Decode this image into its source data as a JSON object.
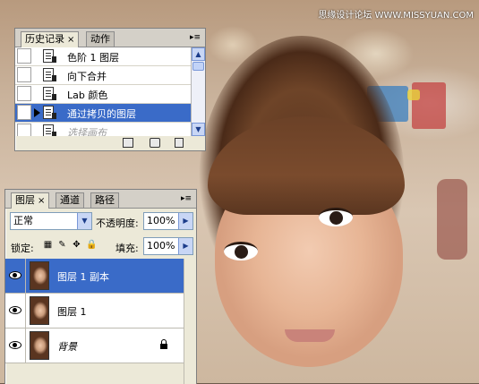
{
  "watermark": "思缘设计论坛 WWW.MISSYUAN.COM",
  "history_panel": {
    "tabs": [
      {
        "label": "历史记录",
        "close": "×"
      },
      {
        "label": "动作"
      }
    ],
    "menu_glyph": "▸≡",
    "items": [
      {
        "label": "色阶 1 图层"
      },
      {
        "label": "向下合并"
      },
      {
        "label": "Lab 颜色"
      },
      {
        "label": "通过拷贝的图层",
        "selected": true
      },
      {
        "label": "选择画布",
        "dimmed": true
      }
    ],
    "footer_icons": [
      "new-document-icon",
      "snapshot-camera-icon",
      "trash-icon"
    ]
  },
  "layers_panel": {
    "tabs": [
      {
        "label": "图层",
        "close": "×"
      },
      {
        "label": "通道"
      },
      {
        "label": "路径"
      }
    ],
    "blend_mode": "正常",
    "opacity_label": "不透明度:",
    "opacity_value": "100%",
    "lock_label": "锁定:",
    "fill_label": "填充:",
    "fill_value": "100%",
    "layers": [
      {
        "name": "图层 1 副本",
        "selected": true,
        "visible": true
      },
      {
        "name": "图层 1",
        "selected": false,
        "visible": true
      },
      {
        "name": "背景",
        "selected": false,
        "visible": true,
        "locked": true,
        "italic": true
      }
    ]
  },
  "glyphs": {
    "close": "×",
    "dropdown": "▼",
    "spin": "▶",
    "scroll_up": "▲",
    "scroll_down": "▼",
    "lock_pixels_icon": "▦",
    "lock_brush_icon": "✎",
    "lock_move_icon": "✥",
    "lock_all_icon": "🔒"
  }
}
